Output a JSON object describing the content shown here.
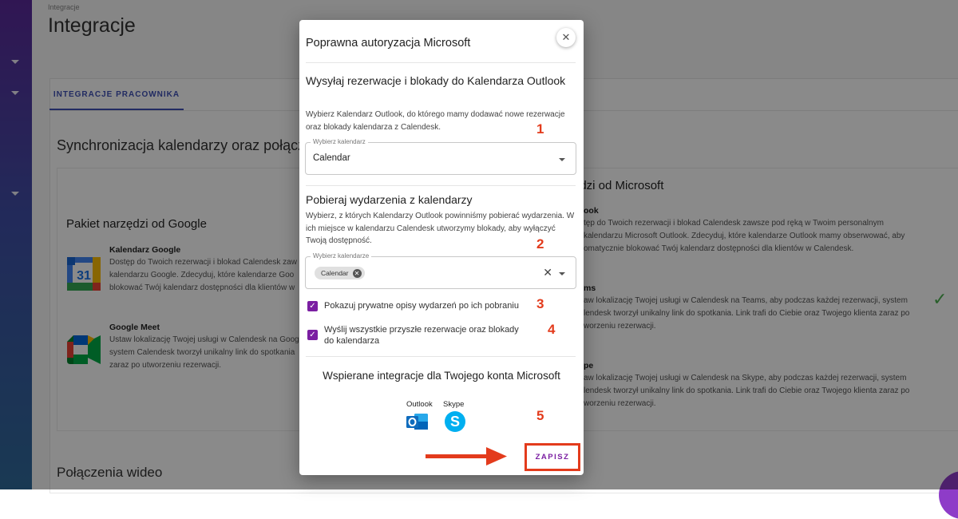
{
  "page": {
    "breadcrumb": "Integracje",
    "title": "Integracje",
    "tab_label": "INTEGRACJE PRACOWNIKA",
    "sync_heading": "Synchronizacja kalendarzy oraz połącze",
    "google": {
      "section_title": "Pakiet narzędzi od Google",
      "calendar_title": "Kalendarz Google",
      "calendar_desc": "Dostęp do Twoich rezerwacji i blokad Calendesk zaw kalendarzu Google. Zdecyduj, które kalendarze Goo blokować Twój kalendarz dostępności dla klientów w",
      "meet_title": "Google Meet",
      "meet_desc": "Ustaw lokalizację Twojej usługi w Calendesk na Goog system Calendesk tworzył unikalny link do spotkania zaraz po utworzeniu rezerwacji."
    },
    "microsoft": {
      "section_title": "ędzi od Microsoft",
      "outlook_title": "ook",
      "outlook_desc": "tęp do Twoich rezerwacji i blokad Calendesk zawsze pod ręką w Twoim personalnym kalendarzu Microsoft Outlook. Zdecyduj, które kalendarze Outlook mamy obserwować, aby omatycznie blokować Twój kalendarz dostępności dla klientów w Calendesk.",
      "teams_title": "ms",
      "teams_desc": "aw lokalizację Twojej usługi w Calendesk na Teams, aby podczas każdej rezerwacji, system lendesk tworzył unikalny link do spotkania. Link trafi do Ciebie oraz Twojego klienta zaraz po worzeniu rezerwacji.",
      "skype_title": "pe",
      "skype_desc": "aw lokalizację Twojej usługi w Calendesk na Skype, aby podczas każdej rezerwacji, system lendesk tworzył unikalny link do spotkania. Link trafi do Ciebie oraz Twojego klienta zaraz po worzeniu rezerwacji."
    },
    "video_heading": "Połączenia wideo"
  },
  "modal": {
    "title": "Poprawna autoryzacja Microsoft",
    "send_heading": "Wysyłaj rezerwacje i blokady do Kalendarza Outlook",
    "send_desc": "Wybierz Kalendarz Outlook, do którego mamy dodawać nowe rezerwacje oraz blokady kalendarza z Calendesk.",
    "select_calendar": {
      "label": "Wybierz kalendarz",
      "value": "Calendar"
    },
    "fetch_heading": "Pobieraj wydarzenia z kalendarzy",
    "fetch_desc": "Wybierz, z których Kalendarzy Outlook powinniśmy pobierać wydarzenia. W ich miejsce w kalendarzu Calendesk utworzymy blokady, aby wyłączyć Twoją dostępność.",
    "select_calendars": {
      "label": "Wybierz kalendarze",
      "chip": "Calendar"
    },
    "checkbox_private": "Pokazuj prywatne opisy wydarzeń po ich pobraniu",
    "checkbox_send_all": "Wyślij wszystkie przyszłe rezerwacje oraz blokady do kalendarza",
    "supported_heading": "Wspierane integracje dla Twojego konta Microsoft",
    "icons": [
      {
        "label": "Outlook",
        "icon": "outlook-icon"
      },
      {
        "label": "Skype",
        "icon": "skype-icon"
      }
    ],
    "save_label": "ZAPISZ",
    "close_icon": "close-icon",
    "step_numbers": [
      "1",
      "2",
      "3",
      "4",
      "5"
    ]
  },
  "colors": {
    "accent": "#7b1fa2",
    "annotation": "#e33b1c",
    "tab": "#3f51b5"
  }
}
